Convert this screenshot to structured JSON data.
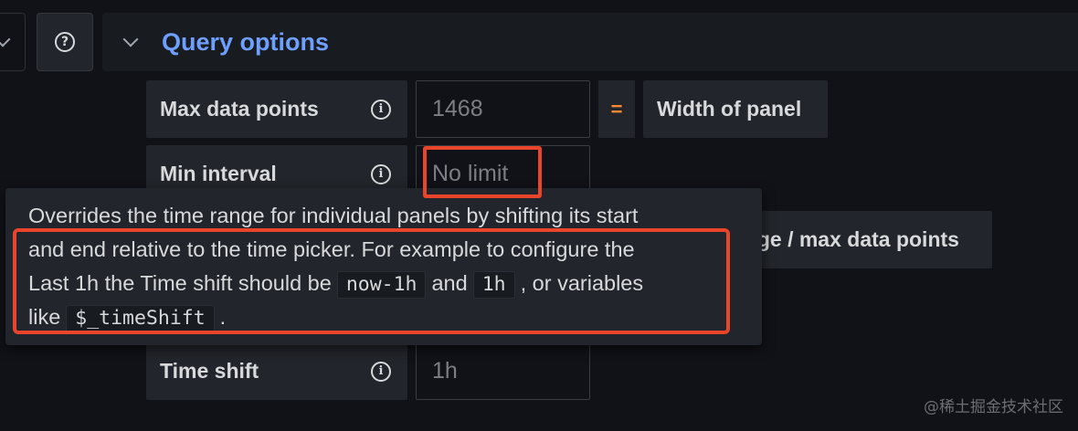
{
  "section": {
    "title": "Query options"
  },
  "fields": {
    "max_data_points": {
      "label": "Max data points",
      "placeholder": "1468"
    },
    "min_interval": {
      "label": "Min interval",
      "placeholder": "No limit"
    },
    "time_shift": {
      "label": "Time shift",
      "placeholder": "1h"
    }
  },
  "equals_sign": "=",
  "width_of_panel": "Width of panel",
  "range_label": "ange / max data points",
  "tooltip": {
    "line1": "Overrides the time range for individual panels by shifting its start",
    "line2": "and end relative to the time picker. For example to configure the",
    "line3_a": "Last 1h the Time shift should be",
    "code1": "now-1h",
    "line3_b": "and",
    "code2": "1h",
    "line3_c": ", or variables",
    "line4_a": "like",
    "code3": "$_timeShift",
    "line4_b": "."
  },
  "watermark": "@稀土掘金技术社区",
  "colors": {
    "accent": "#6e9fff",
    "equals": "#ff8833",
    "highlight": "#e9452b"
  }
}
